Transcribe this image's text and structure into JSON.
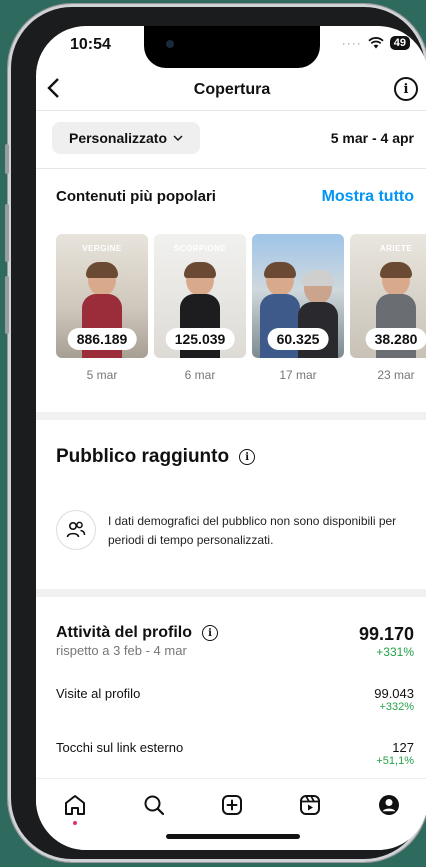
{
  "status": {
    "time": "10:54",
    "battery": "49"
  },
  "header": {
    "title": "Copertura"
  },
  "filter": {
    "label": "Personalizzato",
    "range": "5 mar - 4 apr"
  },
  "popular": {
    "title": "Contenuti più popolari",
    "show_all": "Mostra tutto",
    "items": [
      {
        "caption": "VERGINE",
        "count": "886.189",
        "date": "5 mar"
      },
      {
        "caption": "SCORPIONE",
        "count": "125.039",
        "date": "6 mar"
      },
      {
        "caption": "",
        "count": "60.325",
        "date": "17 mar"
      },
      {
        "caption": "ARIETE",
        "count": "38.280",
        "date": "23 mar"
      }
    ]
  },
  "audience": {
    "title": "Pubblico raggiunto",
    "message": "I dati demografici del pubblico non sono disponibili per periodi di tempo personalizzati."
  },
  "activity": {
    "title": "Attività del profilo",
    "subtitle": "rispetto a 3 feb - 4 mar",
    "total": "99.170",
    "total_delta": "+331%",
    "rows": [
      {
        "label": "Visite al profilo",
        "value": "99.043",
        "delta": "+332%"
      },
      {
        "label": "Tocchi sul link esterno",
        "value": "127",
        "delta": "+51,1%"
      }
    ]
  },
  "colors": {
    "accent": "#0095f6",
    "positive": "#24a148",
    "notification": "#e1306c"
  },
  "nav": [
    "home-icon",
    "search-icon",
    "create-icon",
    "reels-icon",
    "profile-icon"
  ]
}
